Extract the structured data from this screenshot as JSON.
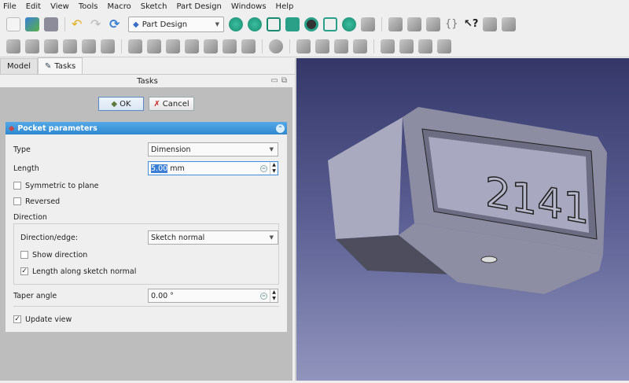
{
  "menu": [
    "File",
    "Edit",
    "View",
    "Tools",
    "Macro",
    "Sketch",
    "Part Design",
    "Windows",
    "Help"
  ],
  "workbench": "Part Design",
  "tabs": {
    "model": "Model",
    "tasks": "Tasks"
  },
  "tasks_title": "Tasks",
  "buttons": {
    "ok": "OK",
    "cancel": "Cancel"
  },
  "pocket": {
    "title": "Pocket parameters",
    "type_label": "Type",
    "type_value": "Dimension",
    "length_label": "Length",
    "length_value": "5.00",
    "length_unit": "mm",
    "symmetric": "Symmetric to plane",
    "reversed": "Reversed",
    "direction_label": "Direction",
    "direction_edge_label": "Direction/edge:",
    "direction_edge_value": "Sketch normal",
    "show_direction": "Show direction",
    "length_along": "Length along sketch normal",
    "taper_label": "Taper angle",
    "taper_value": "0.00 °",
    "update_view": "Update view",
    "checks": {
      "symmetric": false,
      "reversed": false,
      "show_direction": false,
      "length_along": true,
      "update_view": true
    }
  },
  "model_text": "2141"
}
